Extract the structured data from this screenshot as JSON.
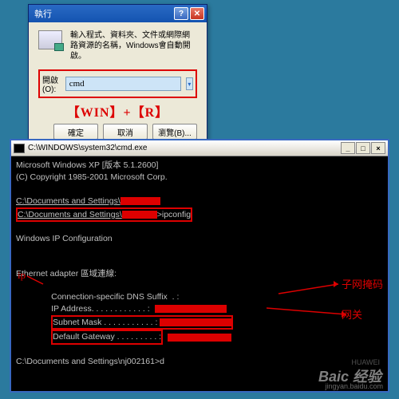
{
  "run": {
    "title": "執行",
    "description": "輸入程式、資料夾、文件或網際網路資源的名稱，Windows會自動開啟。",
    "label": "開啟(O):",
    "value": "cmd",
    "shortcut": "【WIN】+【R】",
    "ok": "確定",
    "cancel": "取消",
    "browse": "瀏覽(B)..."
  },
  "terminal": {
    "title": "C:\\WINDOWS\\system32\\cmd.exe",
    "line1": "Microsoft Windows XP [版本 5.1.2600]",
    "line2": "(C) Copyright 1985-2001 Microsoft Corp.",
    "prompt1": "C:\\Documents and Settings\\",
    "prompt2": "C:\\Documents and Settings\\",
    "cmd2": ">ipconfig",
    "heading": "Windows IP Configuration",
    "adapter": "Ethernet adapter 區域連線:",
    "dns": "Connection-specific DNS Suffix  . :",
    "ipaddr": "IP Address. . . . . . . . . . . . :",
    "subnet": "Subnet Mask . . . . . . . . . . . :",
    "gateway": "Default Gateway . . . . . . . . . :",
    "prompt3": "C:\\Documents and Settings\\nj002161>d"
  },
  "annotations": {
    "ip": "ip",
    "subnet": "子网掩码",
    "gateway": "网关"
  },
  "watermark": {
    "main": "Baic 经验",
    "sub": "jingyan.baidu.com",
    "brand": "HUAWEI"
  }
}
